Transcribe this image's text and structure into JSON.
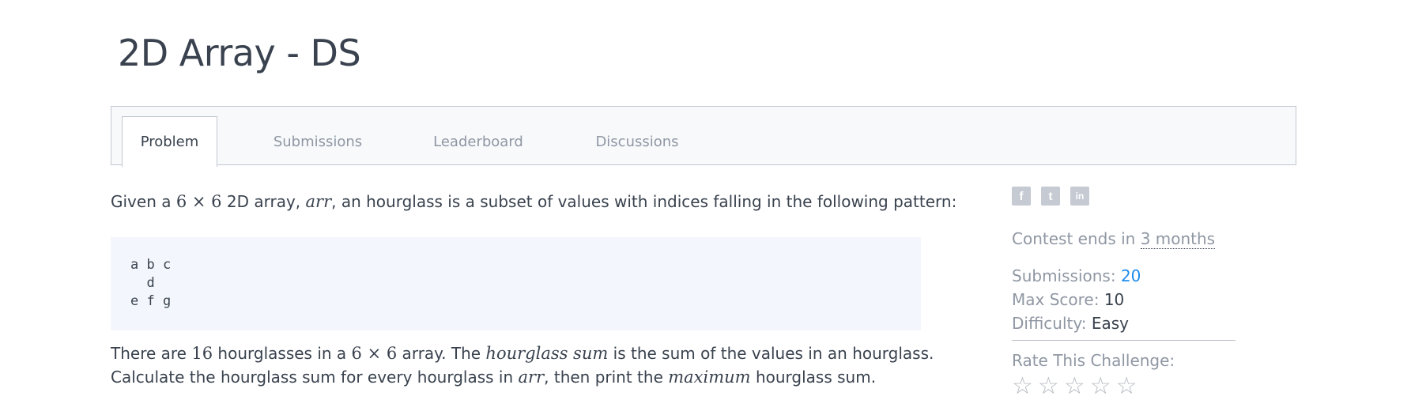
{
  "page": {
    "title": "2D Array - DS"
  },
  "tabs": [
    {
      "label": "Problem",
      "active": true
    },
    {
      "label": "Submissions",
      "active": false
    },
    {
      "label": "Leaderboard",
      "active": false
    },
    {
      "label": "Discussions",
      "active": false
    }
  ],
  "problem": {
    "intro": {
      "t1": "Given a ",
      "m1": "6 × 6",
      "t2": " 2D array, ",
      "m2": "arr",
      "t3": ", an hourglass is a subset of values with indices falling in the following pattern:"
    },
    "pattern": "a b c\n  d\ne f g",
    "line2": {
      "t1": "There are ",
      "m1": "16",
      "t2": " hourglasses in a ",
      "m2": "6 × 6",
      "t3": " array. The ",
      "m3": "hourglass sum",
      "t4": " is the sum of the values in an hourglass."
    },
    "line3": {
      "t1": "Calculate the hourglass sum for every hourglass in ",
      "m1": "arr",
      "t2": ", then print the ",
      "m2": "maximum",
      "t3": " hourglass sum."
    }
  },
  "sidebar": {
    "social": [
      {
        "icon": "facebook-icon",
        "glyph": "f"
      },
      {
        "icon": "twitter-icon",
        "glyph": "t"
      },
      {
        "icon": "linkedin-icon",
        "glyph": "in"
      }
    ],
    "contest_prefix": "Contest ends in ",
    "contest_time": "3 months",
    "submissions_label": "Submissions: ",
    "submissions_value": "20",
    "max_score_label": "Max Score: ",
    "max_score_value": "10",
    "difficulty_label": "Difficulty: ",
    "difficulty_value": "Easy",
    "rate_label": "Rate This Challenge:",
    "stars": [
      "☆",
      "☆",
      "☆",
      "☆",
      "☆"
    ]
  },
  "colors": {
    "link": "#1f8ceb",
    "text": "#39424e",
    "muted": "#8f97a3",
    "code_bg": "#f3f7fd"
  }
}
